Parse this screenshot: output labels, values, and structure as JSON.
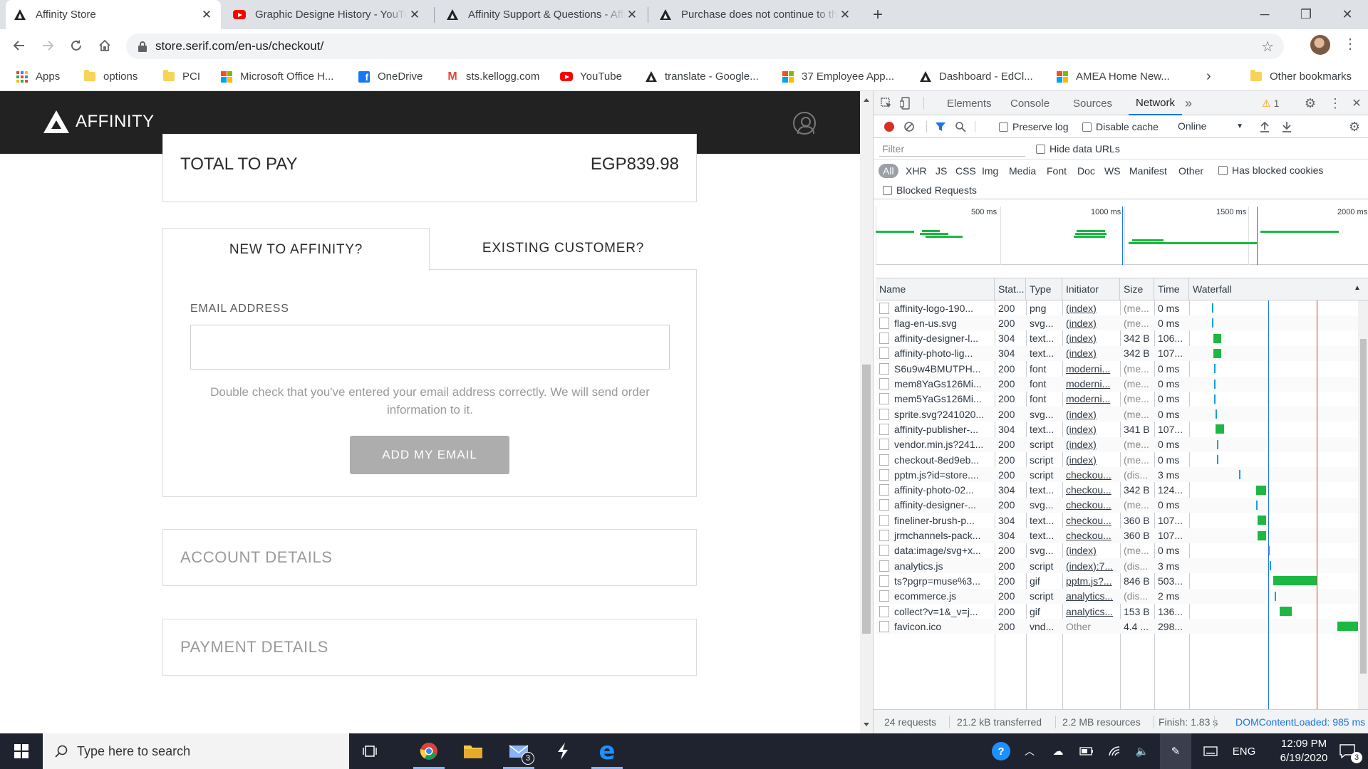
{
  "browser": {
    "tabs": [
      {
        "title": "Affinity Store",
        "active": true,
        "icon": "affinity-icon"
      },
      {
        "title": "Graphic Designe History - YouTube",
        "active": false,
        "icon": "youtube-icon"
      },
      {
        "title": "Affinity Support & Questions - Affinity Forum",
        "active": false,
        "icon": "affinity-icon"
      },
      {
        "title": "Purchase does not continue to the next step",
        "active": false,
        "icon": "affinity-icon"
      }
    ],
    "new_tab": "+",
    "url": "store.serif.com/en-us/checkout/",
    "bookmarks": [
      {
        "label": "Apps",
        "icon": "apps-grid-icon"
      },
      {
        "label": "options",
        "icon": "folder-icon"
      },
      {
        "label": "PCI",
        "icon": "folder-icon"
      },
      {
        "label": "Microsoft Office H...",
        "icon": "microsoft-icon"
      },
      {
        "label": "OneDrive",
        "icon": "facebook-icon"
      },
      {
        "label": "sts.kellogg.com",
        "icon": "gmail-icon"
      },
      {
        "label": "YouTube",
        "icon": "youtube-icon"
      },
      {
        "label": "translate - Google...",
        "icon": "affinity-icon"
      },
      {
        "label": "37 Employee App...",
        "icon": "microsoft-icon"
      },
      {
        "label": "Dashboard - EdCl...",
        "icon": "affinity-icon"
      },
      {
        "label": "AMEA Home New...",
        "icon": "microsoft-icon"
      }
    ],
    "other_bookmarks": "Other bookmarks"
  },
  "site": {
    "logo_text": "AFFINITY",
    "total_label": "TOTAL TO PAY",
    "total_value": "EGP839.98",
    "tab_new": "NEW TO AFFINITY?",
    "tab_existing": "EXISTING CUSTOMER?",
    "email_label": "EMAIL ADDRESS",
    "email_value": "",
    "email_help": "Double check that you've entered your email address correctly. We will send order information to it.",
    "add_email_button": "ADD MY EMAIL",
    "account_details": "ACCOUNT DETAILS",
    "payment_details": "PAYMENT DETAILS"
  },
  "devtools": {
    "tabs": [
      "Elements",
      "Console",
      "Sources",
      "Network"
    ],
    "active_tab": "Network",
    "more_tabs": "»",
    "warning_count": "1",
    "toolbar": {
      "preserve_log": "Preserve log",
      "disable_cache": "Disable cache",
      "throttle": "Online"
    },
    "filter_placeholder": "Filter",
    "hide_data_urls": "Hide data URLs",
    "filter_types": [
      "All",
      "XHR",
      "JS",
      "CSS",
      "Img",
      "Media",
      "Font",
      "Doc",
      "WS",
      "Manifest",
      "Other"
    ],
    "has_blocked_cookies": "Has blocked cookies",
    "blocked_requests": "Blocked Requests",
    "overview_ticks": [
      "500 ms",
      "1000 ms",
      "1500 ms",
      "2000 ms"
    ],
    "columns": [
      "Name",
      "Stat...",
      "Type",
      "Initiator",
      "Size",
      "Time",
      "Waterfall"
    ],
    "requests": [
      {
        "name": "affinity-logo-190...",
        "status": "200",
        "type": "png",
        "initiator": "(index)",
        "size": "(me...",
        "time": "0 ms",
        "wf_start": 0.09,
        "wf_dur": 0.01
      },
      {
        "name": "flag-en-us.svg",
        "status": "200",
        "type": "svg...",
        "initiator": "(index)",
        "size": "(me...",
        "time": "0 ms",
        "wf_start": 0.09,
        "wf_dur": 0.01
      },
      {
        "name": "affinity-designer-l...",
        "status": "304",
        "type": "text...",
        "initiator": "(index)",
        "size": "342 B",
        "time": "106...",
        "wf_start": 0.095,
        "wf_dur": 0.05
      },
      {
        "name": "affinity-photo-lig...",
        "status": "304",
        "type": "text...",
        "initiator": "(index)",
        "size": "342 B",
        "time": "107...",
        "wf_start": 0.095,
        "wf_dur": 0.05
      },
      {
        "name": "S6u9w4BMUTPH...",
        "status": "200",
        "type": "font",
        "initiator": "moderni...",
        "size": "(me...",
        "time": "0 ms",
        "wf_start": 0.1,
        "wf_dur": 0.01
      },
      {
        "name": "mem8YaGs126Mi...",
        "status": "200",
        "type": "font",
        "initiator": "moderni...",
        "size": "(me...",
        "time": "0 ms",
        "wf_start": 0.1,
        "wf_dur": 0.01
      },
      {
        "name": "mem5YaGs126Mi...",
        "status": "200",
        "type": "font",
        "initiator": "moderni...",
        "size": "(me...",
        "time": "0 ms",
        "wf_start": 0.1,
        "wf_dur": 0.01
      },
      {
        "name": "sprite.svg?241020...",
        "status": "200",
        "type": "svg...",
        "initiator": "(index)",
        "size": "(me...",
        "time": "0 ms",
        "wf_start": 0.11,
        "wf_dur": 0.01
      },
      {
        "name": "affinity-publisher-...",
        "status": "304",
        "type": "text...",
        "initiator": "(index)",
        "size": "341 B",
        "time": "107...",
        "wf_start": 0.11,
        "wf_dur": 0.05
      },
      {
        "name": "vendor.min.js?241...",
        "status": "200",
        "type": "script",
        "initiator": "(index)",
        "size": "(me...",
        "time": "0 ms",
        "wf_start": 0.12,
        "wf_dur": 0.01
      },
      {
        "name": "checkout-8ed9eb...",
        "status": "200",
        "type": "script",
        "initiator": "(index)",
        "size": "(me...",
        "time": "0 ms",
        "wf_start": 0.12,
        "wf_dur": 0.01
      },
      {
        "name": "pptm.js?id=store....",
        "status": "200",
        "type": "script",
        "initiator": "checkou...",
        "size": "(dis...",
        "time": "3 ms",
        "wf_start": 0.25,
        "wf_dur": 0.01
      },
      {
        "name": "affinity-photo-02...",
        "status": "304",
        "type": "text...",
        "initiator": "checkou...",
        "size": "342 B",
        "time": "124...",
        "wf_start": 0.35,
        "wf_dur": 0.06
      },
      {
        "name": "affinity-designer-...",
        "status": "200",
        "type": "svg...",
        "initiator": "checkou...",
        "size": "(me...",
        "time": "0 ms",
        "wf_start": 0.35,
        "wf_dur": 0.01
      },
      {
        "name": "fineliner-brush-p...",
        "status": "304",
        "type": "text...",
        "initiator": "checkou...",
        "size": "360 B",
        "time": "107...",
        "wf_start": 0.36,
        "wf_dur": 0.05
      },
      {
        "name": "jrmchannels-pack...",
        "status": "304",
        "type": "text...",
        "initiator": "checkou...",
        "size": "360 B",
        "time": "107...",
        "wf_start": 0.36,
        "wf_dur": 0.05
      },
      {
        "name": "data:image/svg+x...",
        "status": "200",
        "type": "svg...",
        "initiator": "(index)",
        "size": "(me...",
        "time": "0 ms",
        "wf_start": 0.42,
        "wf_dur": 0.01
      },
      {
        "name": "analytics.js",
        "status": "200",
        "type": "script",
        "initiator": "(index):7...",
        "size": "(dis...",
        "time": "3 ms",
        "wf_start": 0.43,
        "wf_dur": 0.01
      },
      {
        "name": "ts?pgrp=muse%3...",
        "status": "200",
        "type": "gif",
        "initiator": "pptm.js?...",
        "size": "846 B",
        "time": "503...",
        "wf_start": 0.45,
        "wf_dur": 0.26
      },
      {
        "name": "ecommerce.js",
        "status": "200",
        "type": "script",
        "initiator": "analytics...",
        "size": "(dis...",
        "time": "2 ms",
        "wf_start": 0.46,
        "wf_dur": 0.01
      },
      {
        "name": "collect?v=1&_v=j...",
        "status": "200",
        "type": "gif",
        "initiator": "analytics...",
        "size": "153 B",
        "time": "136...",
        "wf_start": 0.49,
        "wf_dur": 0.07
      },
      {
        "name": "favicon.ico",
        "status": "200",
        "type": "vnd...",
        "initiator": "Other",
        "size": "4.4 ...",
        "time": "298...",
        "wf_start": 0.83,
        "wf_dur": 0.17
      }
    ],
    "status_bar": {
      "requests": "24 requests",
      "transferred": "21.2 kB transferred",
      "resources": "2.2 MB resources",
      "finish": "Finish: 1.83 s",
      "dcl": "DOMContentLoaded: 985 ms"
    }
  },
  "taskbar": {
    "search_placeholder": "Type here to search",
    "mail_badge": "3",
    "lang": "ENG",
    "time": "12:09 PM",
    "date": "6/19/2020"
  },
  "colors": {
    "accent": "#1a73e8",
    "waterfall_green": "#1cb842",
    "waterfall_blue": "#1a9ed8",
    "record_red": "#d93025"
  }
}
